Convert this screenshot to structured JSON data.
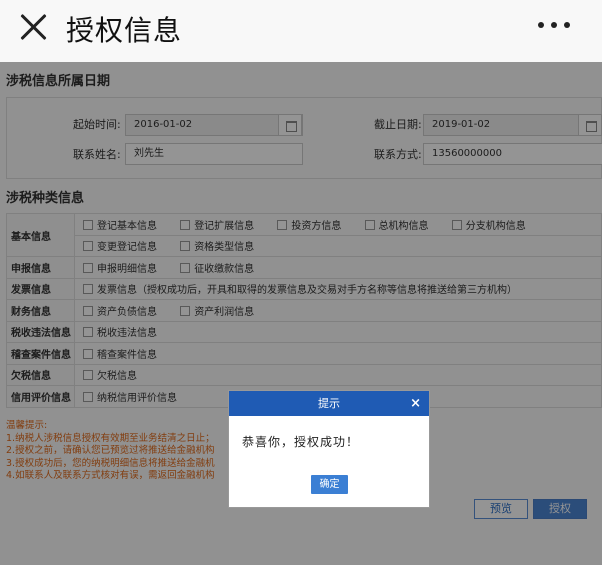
{
  "header": {
    "title": "授权信息"
  },
  "section1": {
    "title": "涉税信息所属日期",
    "start_label": "起始时间:",
    "start_value": "2016-01-02",
    "end_label": "截止日期:",
    "end_value": "2019-01-02",
    "contact_label": "联系姓名:",
    "contact_value": "刘先生",
    "phone_label": "联系方式:",
    "phone_value": "13560000000"
  },
  "section2": {
    "title": "涉税种类信息",
    "rows": [
      {
        "header": "基本信息",
        "options": [
          "登记基本信息",
          "登记扩展信息",
          "投资方信息",
          "总机构信息",
          "分支机构信息"
        ]
      },
      {
        "header": "",
        "options": [
          "变更登记信息",
          "资格类型信息"
        ]
      },
      {
        "header": "申报信息",
        "options": [
          "申报明细信息",
          "征收缴款信息"
        ]
      },
      {
        "header": "发票信息",
        "options": [
          "发票信息（授权成功后，开具和取得的发票信息及交易对手方名称等信息将推送给第三方机构）"
        ]
      },
      {
        "header": "财务信息",
        "options": [
          "资产负债信息",
          "资产利润信息"
        ]
      },
      {
        "header": "税收违法信息",
        "options": [
          "税收违法信息"
        ]
      },
      {
        "header": "稽查案件信息",
        "options": [
          "稽查案件信息"
        ]
      },
      {
        "header": "欠税信息",
        "options": [
          "欠税信息"
        ]
      },
      {
        "header": "信用评价信息",
        "options": [
          "纳税信用评价信息"
        ]
      }
    ]
  },
  "tips": {
    "title": "温馨提示:",
    "lines": [
      "1.纳税人涉税信息授权有效期至业务结清之日止；",
      "2.授权之前，请确认您已预览过将推送给金融机构",
      "3.授权成功后，您的纳税明细信息将推送给金融机",
      "4.如联系人及联系方式核对有误，需返回金融机构"
    ]
  },
  "buttons": {
    "preview": "预览",
    "authorize": "授权"
  },
  "dialog": {
    "title": "提示",
    "close": "×",
    "message": "恭喜你，授权成功！",
    "ok": "确定"
  },
  "colors": {
    "dialog_header": "#1f5bb4",
    "tips_text": "#e06a1b",
    "primary_button": "#4a85d3"
  }
}
